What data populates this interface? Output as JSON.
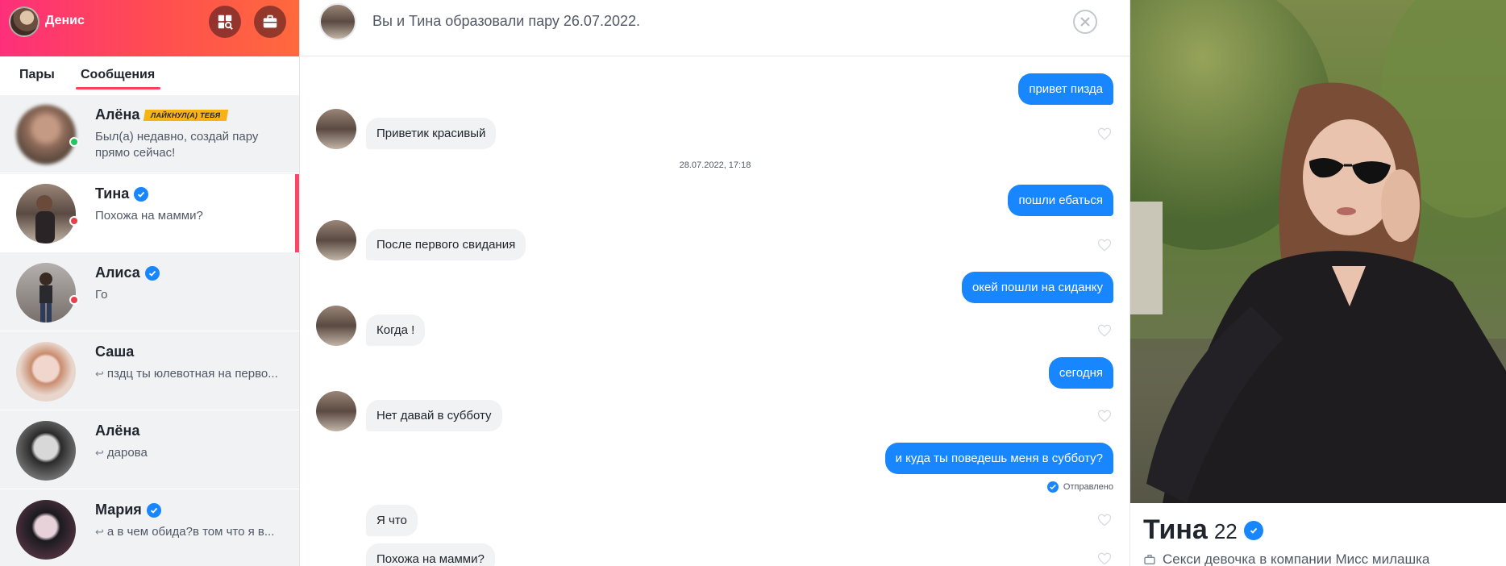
{
  "header": {
    "user_name": "Денис",
    "explore_button": "explore-icon",
    "work_button": "briefcase-icon"
  },
  "tabs": {
    "pairs": "Пары",
    "messages": "Сообщения"
  },
  "conversations": [
    {
      "name": "Алёна",
      "badge": "ЛАЙКНУЛ(А) ТЕБЯ",
      "preview": "Был(а) недавно, создай пару прямо сейчас!",
      "status": "online"
    },
    {
      "name": "Тина",
      "verified": true,
      "preview": "Похожа на мамми?",
      "status": "offline",
      "selected": true
    },
    {
      "name": "Алиса",
      "verified": true,
      "preview": "Го",
      "status": "offline"
    },
    {
      "name": "Саша",
      "preview": "пздц ты юлевотная на перво...",
      "replied": true
    },
    {
      "name": "Алёна",
      "preview": "дарова",
      "replied": true
    },
    {
      "name": "Мария",
      "verified": true,
      "preview": "а в чем обида?в том что я в...",
      "replied": true
    }
  ],
  "chat": {
    "title": "Вы и Тина образовали пару 26.07.2022.",
    "messages": [
      {
        "dir": "out",
        "text": "привет пизда"
      },
      {
        "dir": "in",
        "text": "Приветик красивый"
      },
      {
        "dir": "ts",
        "text": "28.07.2022, 17:18"
      },
      {
        "dir": "out",
        "text": "пошли ебаться"
      },
      {
        "dir": "in",
        "text": "После первого свидания"
      },
      {
        "dir": "out",
        "text": "окей пошли на сиданку"
      },
      {
        "dir": "in",
        "text": "Когда !"
      },
      {
        "dir": "out",
        "text": "сегодня"
      },
      {
        "dir": "in",
        "text": "Нет давай в субботу"
      },
      {
        "dir": "out",
        "text": "и куда ты поведешь меня в субботу?"
      },
      {
        "dir": "in",
        "text": "Я что"
      },
      {
        "dir": "in",
        "text": "Похожа на мамми?"
      }
    ],
    "sent_status": "Отправлено"
  },
  "profile": {
    "name": "Тина",
    "age": "22",
    "job": "Секси девочка в компании Мисс милашка"
  },
  "colors": {
    "accent": "#fd3d5c",
    "bubble_out": "#1786ff",
    "bubble_in": "#f0f2f4",
    "online": "#22c55e",
    "offline": "#e8404a"
  }
}
